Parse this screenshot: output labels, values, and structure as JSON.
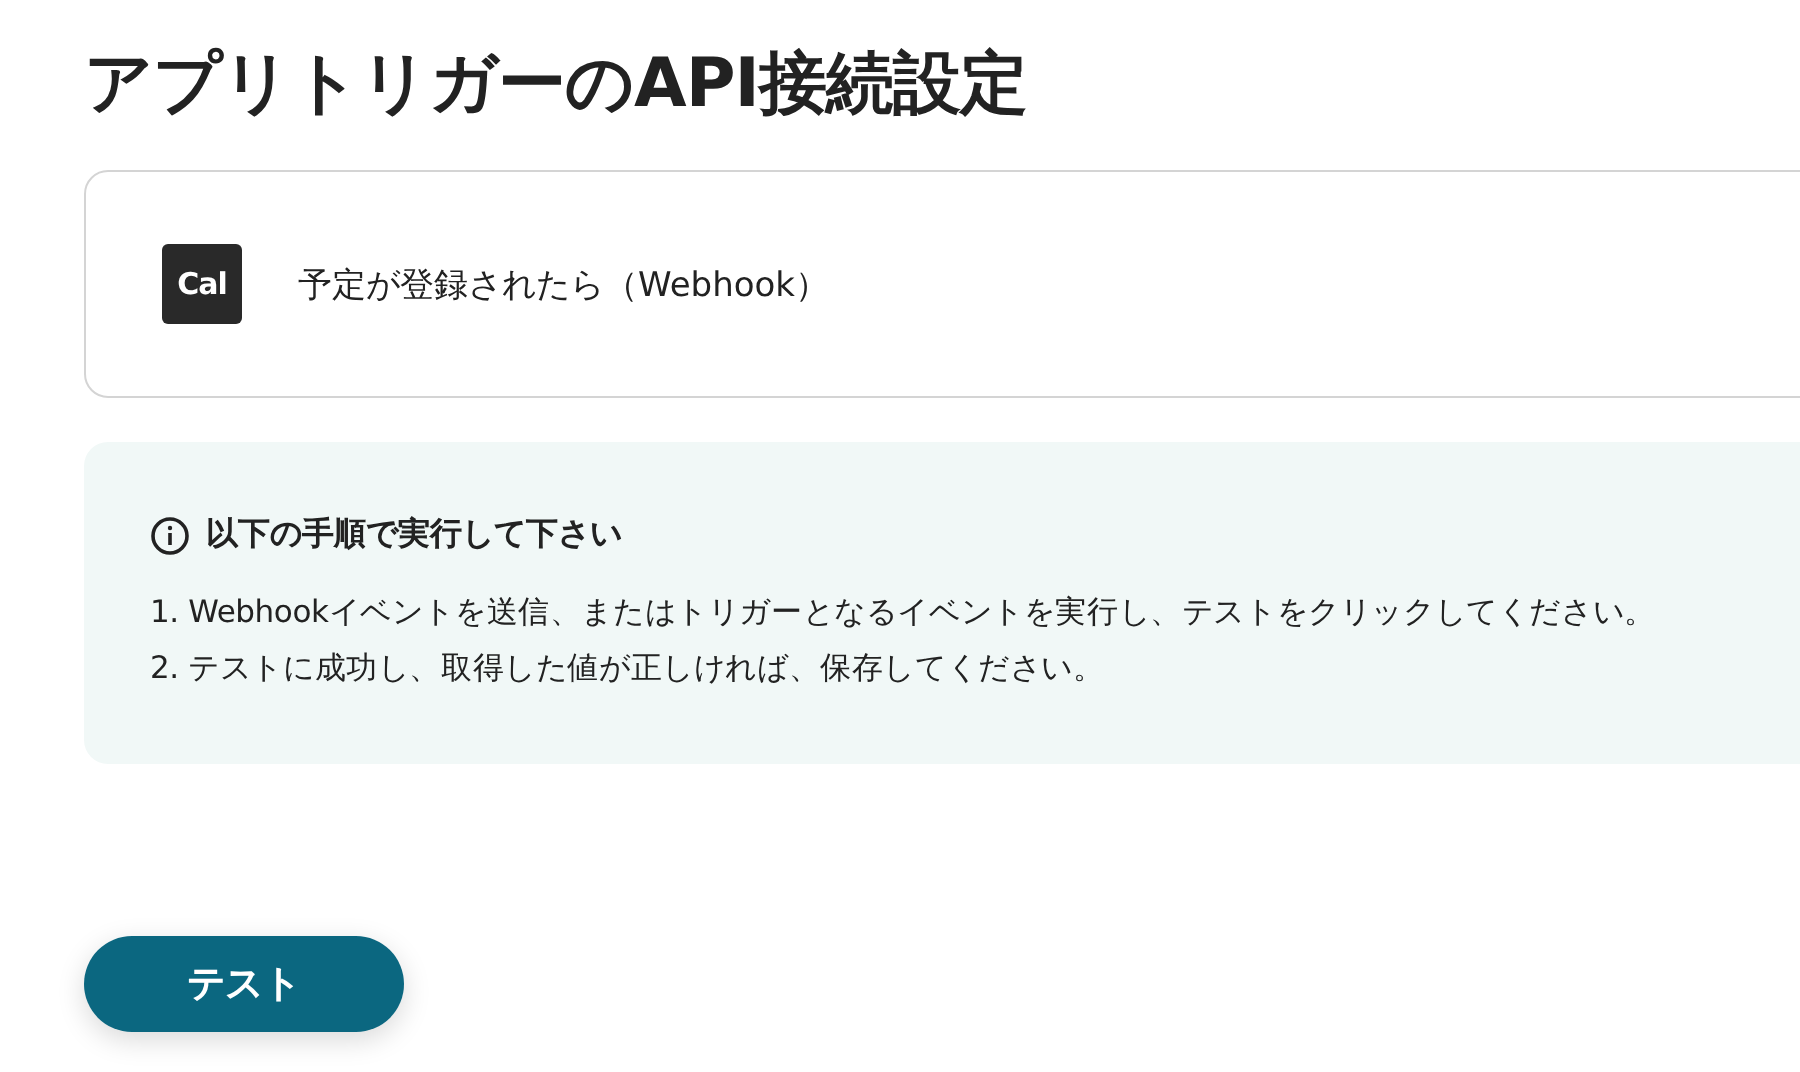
{
  "title": "アプリトリガーのAPI接続設定",
  "trigger": {
    "app_logo": "Cal",
    "label": "予定が登録されたら（Webhook）"
  },
  "instructions": {
    "heading": "以下の手順で実行して下さい",
    "steps": [
      "1. Webhookイベントを送信、またはトリガーとなるイベントを実行し、テストをクリックしてください。",
      "2. テストに成功し、取得した値が正しければ、保存してください。"
    ]
  },
  "buttons": [
    {
      "label": "テスト"
    }
  ]
}
